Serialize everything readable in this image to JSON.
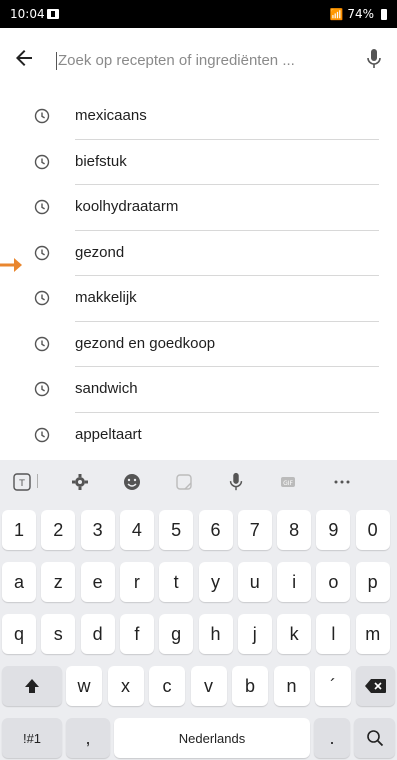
{
  "status": {
    "time": "10:04",
    "battery": "74%"
  },
  "search": {
    "placeholder": "Zoek op recepten of ingrediënten ..."
  },
  "recent_searches": [
    "mexicaans",
    "biefstuk",
    "koolhydraatarm",
    "gezond",
    "makkelijk",
    "gezond en goedkoop",
    "sandwich",
    "appeltaart"
  ],
  "keyboard": {
    "toolbar_icons": [
      "translate-icon",
      "gear-icon",
      "emoji-icon",
      "sticker-icon",
      "mic-icon",
      "gif-icon",
      "more-icon"
    ],
    "number_row": [
      "1",
      "2",
      "3",
      "4",
      "5",
      "6",
      "7",
      "8",
      "9",
      "0"
    ],
    "row1": [
      "a",
      "z",
      "e",
      "r",
      "t",
      "y",
      "u",
      "i",
      "o",
      "p"
    ],
    "row2": [
      "q",
      "s",
      "d",
      "f",
      "g",
      "h",
      "j",
      "k",
      "l",
      "m"
    ],
    "row3": [
      "w",
      "x",
      "c",
      "v",
      "b",
      "n",
      "´"
    ],
    "symbols_label": "!#1",
    "comma_label": ",",
    "space_label": "Nederlands",
    "period_label": "."
  }
}
